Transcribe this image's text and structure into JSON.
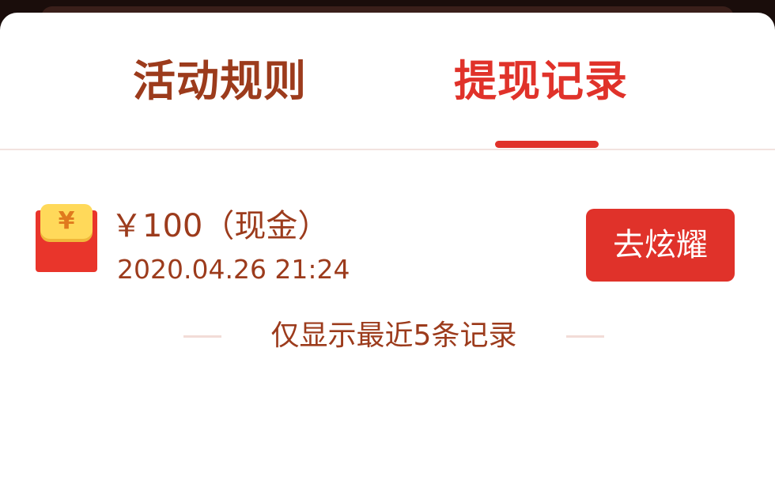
{
  "tabs": {
    "rules_label": "活动规则",
    "records_label": "提现记录",
    "active": "records"
  },
  "record": {
    "currency_symbol": "¥",
    "amount_text": "￥100（现金）",
    "date": "2020.04.26 21:24",
    "action_label": "去炫耀"
  },
  "footer": {
    "note": "仅显示最近5条记录"
  },
  "colors": {
    "accent": "#e0322a",
    "text": "#9c3b1c",
    "panel": "#ffffff",
    "backdrop": "#1a0d0b"
  },
  "icons": {
    "envelope": "red-envelope-icon"
  }
}
